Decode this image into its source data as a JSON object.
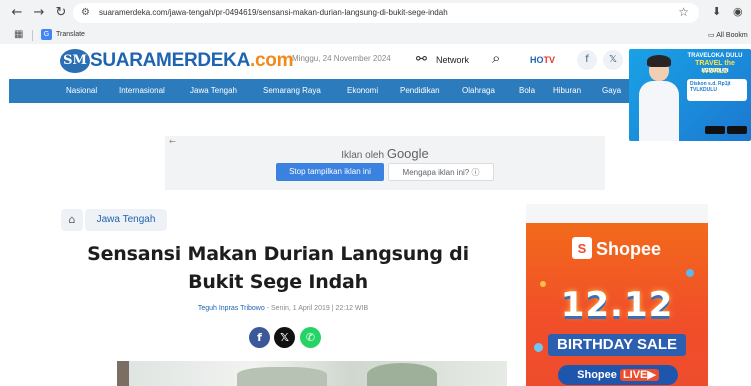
{
  "browser": {
    "url": "suaramerdeka.com/jawa-tengah/pr-0494619/sensansi-makan-durian-langsung-di-bukit-sege-indah",
    "bookmarks": {
      "translate": "Translate",
      "all_bookmarks": "All Bookm"
    },
    "icons": [
      "back-icon",
      "forward-icon",
      "reload-icon",
      "site-info-icon",
      "star-icon",
      "download-icon",
      "profile-icon",
      "apps-icon",
      "folder-icon"
    ]
  },
  "header": {
    "logo_main": "SUARAMERDEKA",
    "logo_suffix": ".com",
    "logo_mark": "SM",
    "date": "Minggu, 24 November 2024",
    "network_label": "Network",
    "hotv_a": "HO",
    "hotv_b": "TV"
  },
  "nav": {
    "items": [
      "Nasional",
      "Internasional",
      "Jawa Tengah",
      "Semarang Raya",
      "Ekonomi",
      "Pendidikan",
      "Olahraga",
      "Bola",
      "Hiburan",
      "Gaya"
    ]
  },
  "ad_google": {
    "title": "Iklan oleh",
    "brand": "Google",
    "stop_label": "Stop tampilkan iklan ini",
    "why_label": "Mengapa iklan ini? ⓘ"
  },
  "ad_traveloka": {
    "line1": "TRAVELOKA DULU",
    "line2": "TRAVEL the WORLD",
    "line3": "KEMUDIAN",
    "card": "Diskon s.d. Rp1jt TVLKDULU"
  },
  "breadcrumb": {
    "category": "Jawa Tengah"
  },
  "article": {
    "title": "Sensansi Makan Durian Langsung di Bukit Sege Indah",
    "author": "Teguh Inpras Tribowo",
    "meta": " - Senin, 1 April 2019 | 22:12 WIB"
  },
  "ad_shopee": {
    "brand": "Shopee",
    "promo_number": "12.12",
    "promo_label": "BIRTHDAY SALE",
    "live_label": "Shopee",
    "live_badge": "LIVE▶"
  },
  "colors": {
    "brand_blue": "#1e64b0",
    "brand_orange": "#f28a1a",
    "nav_bar": "#2b7bbd",
    "shopee_orange": "#ee4d2d",
    "facebook": "#3b5998",
    "x": "#111111",
    "whatsapp": "#25d366"
  }
}
